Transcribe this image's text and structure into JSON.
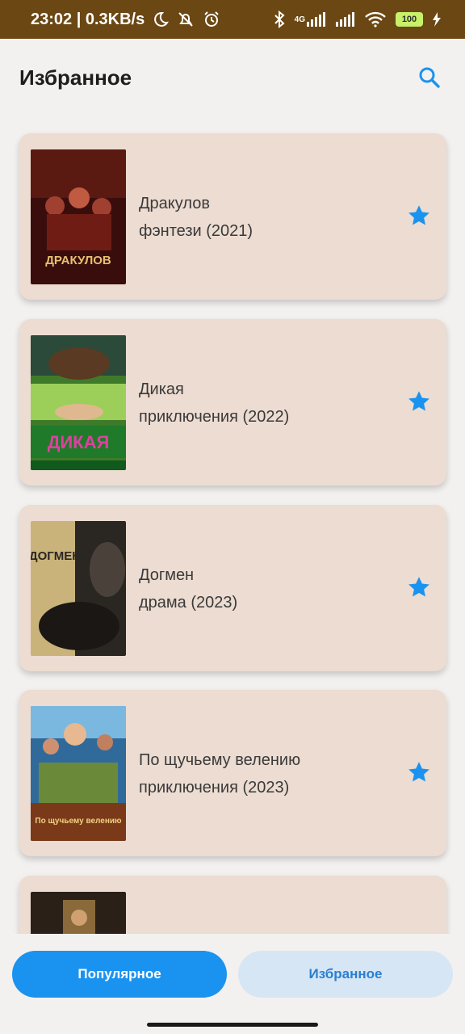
{
  "status_bar": {
    "time_speed": "23:02 | 0.3KB/s",
    "network_label": "4G",
    "battery": "100"
  },
  "header": {
    "title": "Избранное"
  },
  "movies": [
    {
      "title": "Дракулов",
      "subtitle": "фэнтези (2021)",
      "favorite": true
    },
    {
      "title": "Дикая",
      "subtitle": "приключения (2022)",
      "favorite": true
    },
    {
      "title": "Догмен",
      "subtitle": "драма (2023)",
      "favorite": true
    },
    {
      "title": "По щучьему велению",
      "subtitle": "приключения (2023)",
      "favorite": true
    },
    {
      "title": "",
      "subtitle": "",
      "favorite": true
    }
  ],
  "posters": {
    "drakulov_text": "ДРАКУЛОВ",
    "dikaya_text": "ДИКАЯ",
    "dogman_text": "ДОГМЕН",
    "pike_text": "По щучьему велению"
  },
  "bottom_nav": {
    "popular_label": "Популярное",
    "favorites_label": "Избранное"
  },
  "colors": {
    "accent": "#1a93f0",
    "card": "#ecdcd1",
    "status_bar": "#6b4713"
  }
}
